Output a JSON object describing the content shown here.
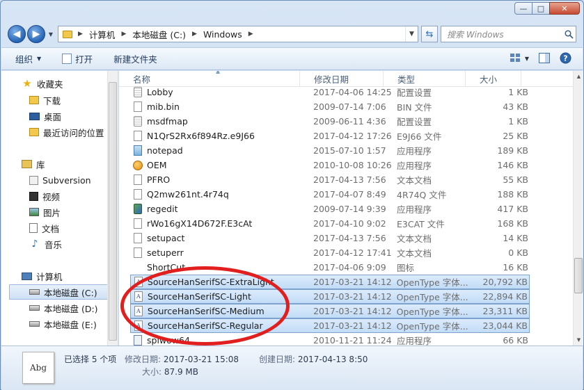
{
  "window": {
    "controls": {
      "minimize": "—",
      "maximize": "□",
      "close": "✕"
    }
  },
  "address": {
    "back_glyph": "◀",
    "forward_glyph": "▶",
    "crumbs": [
      "计算机",
      "本地磁盘 (C:)",
      "Windows"
    ],
    "search_placeholder": "搜索 Windows"
  },
  "toolbar": {
    "organize": "组织",
    "open": "打开",
    "new_folder": "新建文件夹"
  },
  "navpane": {
    "favorites": "收藏夹",
    "downloads": "下载",
    "desktop": "桌面",
    "recent": "最近访问的位置",
    "libraries": "库",
    "subversion": "Subversion",
    "videos": "视频",
    "pictures": "图片",
    "documents": "文档",
    "music": "音乐",
    "computer": "计算机",
    "drive_c": "本地磁盘 (C:)",
    "drive_d": "本地磁盘 (D:)",
    "drive_e": "本地磁盘 (E:)"
  },
  "columns": {
    "name": "名称",
    "date": "修改日期",
    "type": "类型",
    "size": "大小"
  },
  "files": [
    {
      "name": "Lobby",
      "date": "2017-04-06 14:25",
      "type": "配置设置",
      "size": "1 KB",
      "icon": "cog"
    },
    {
      "name": "mib.bin",
      "date": "2009-07-14 7:06",
      "type": "BIN 文件",
      "size": "43 KB",
      "icon": "file"
    },
    {
      "name": "msdfmap",
      "date": "2009-06-11 4:36",
      "type": "配置设置",
      "size": "1 KB",
      "icon": "cog"
    },
    {
      "name": "N1QrS2Rx6f894Rz.e9J66",
      "date": "2017-04-12 17:26",
      "type": "E9J66 文件",
      "size": "25 KB",
      "icon": "file"
    },
    {
      "name": "notepad",
      "date": "2015-07-10 1:57",
      "type": "应用程序",
      "size": "189 KB",
      "icon": "app"
    },
    {
      "name": "OEM",
      "date": "2010-10-08 10:26",
      "type": "应用程序",
      "size": "146 KB",
      "icon": "oem"
    },
    {
      "name": "PFRO",
      "date": "2017-04-13 7:56",
      "type": "文本文档",
      "size": "55 KB",
      "icon": "file"
    },
    {
      "name": "Q2mw261nt.4r74q",
      "date": "2017-04-07 8:49",
      "type": "4R74Q 文件",
      "size": "188 KB",
      "icon": "file"
    },
    {
      "name": "regedit",
      "date": "2009-07-14 9:39",
      "type": "应用程序",
      "size": "417 KB",
      "icon": "reg"
    },
    {
      "name": "rWo16gX14D672F.E3cAt",
      "date": "2017-04-10 9:02",
      "type": "E3CAT 文件",
      "size": "168 KB",
      "icon": "file"
    },
    {
      "name": "setupact",
      "date": "2017-04-13 7:56",
      "type": "文本文档",
      "size": "14 KB",
      "icon": "file"
    },
    {
      "name": "setuperr",
      "date": "2017-04-12 17:41",
      "type": "文本文档",
      "size": "0 KB",
      "icon": "file"
    },
    {
      "name": "ShortCut",
      "date": "2017-04-06 9:09",
      "type": "图标",
      "size": "16 KB",
      "icon": "blank"
    },
    {
      "name": "SourceHanSerifSC-ExtraLight",
      "date": "2017-03-21 14:12",
      "type": "OpenType 字体...",
      "size": "20,792 KB",
      "icon": "font",
      "selected": true
    },
    {
      "name": "SourceHanSerifSC-Light",
      "date": "2017-03-21 14:12",
      "type": "OpenType 字体...",
      "size": "22,894 KB",
      "icon": "font",
      "selected": true
    },
    {
      "name": "SourceHanSerifSC-Medium",
      "date": "2017-03-21 14:12",
      "type": "OpenType 字体...",
      "size": "23,311 KB",
      "icon": "font",
      "selected": true
    },
    {
      "name": "SourceHanSerifSC-Regular",
      "date": "2017-03-21 14:12",
      "type": "OpenType 字体...",
      "size": "23,044 KB",
      "icon": "font",
      "selected": true
    },
    {
      "name": "splwow64",
      "date": "2010-11-21 11:24",
      "type": "应用程序",
      "size": "66 KB",
      "icon": "exe"
    }
  ],
  "details": {
    "thumb_text": "Abg",
    "selection": "已选择 5 个项",
    "modified_label": "修改日期:",
    "modified_value": "2017-03-21 15:08",
    "created_label": "创建日期:",
    "created_value": "2017-04-13 8:50",
    "size_label": "大小:",
    "size_value": "87.9 MB"
  },
  "colors": {
    "annotation": "#e11f1f",
    "selection": "#c2dcf7"
  }
}
